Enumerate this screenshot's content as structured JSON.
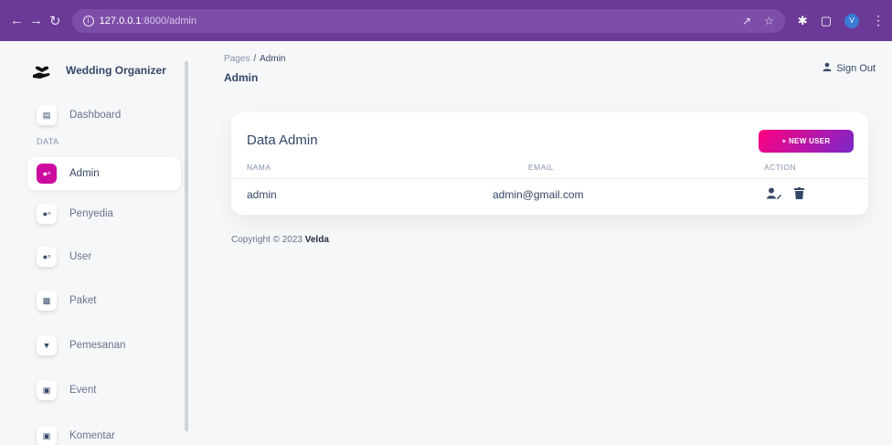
{
  "browser": {
    "url_host": "127.0.0.1",
    "url_rest": ":8000/admin",
    "profile_initial": "V"
  },
  "sidebar": {
    "brand": "Wedding Organizer",
    "section_label": "DATA",
    "items": [
      {
        "label": "Dashboard",
        "icon": "store-icon"
      },
      {
        "label": "Admin",
        "icon": "users-icon",
        "active": true
      },
      {
        "label": "Penyedia",
        "icon": "users-icon"
      },
      {
        "label": "User",
        "icon": "users-icon"
      },
      {
        "label": "Paket",
        "icon": "chart-icon"
      },
      {
        "label": "Pemesanan",
        "icon": "cart-icon"
      },
      {
        "label": "Event",
        "icon": "calendar-icon"
      },
      {
        "label": "Komentar",
        "icon": "calendar-icon"
      }
    ]
  },
  "header": {
    "breadcrumb_root": "Pages",
    "breadcrumb_sep": "/",
    "breadcrumb_current": "Admin",
    "title": "Admin",
    "signout": "Sign Out"
  },
  "card": {
    "title": "Data Admin",
    "new_user_button": "+ NEW USER",
    "columns": [
      "NAMA",
      "EMAIL",
      "ACTION"
    ],
    "rows": [
      {
        "nama": "admin",
        "email": "admin@gmail.com"
      }
    ]
  },
  "footer": {
    "text": "Copyright © 2023",
    "author": "Velda"
  },
  "colors": {
    "browser_bar": "#6a3a96",
    "accent_start": "#7928ca",
    "accent_end": "#ff0080",
    "active_icon": "#cb0c9f"
  }
}
